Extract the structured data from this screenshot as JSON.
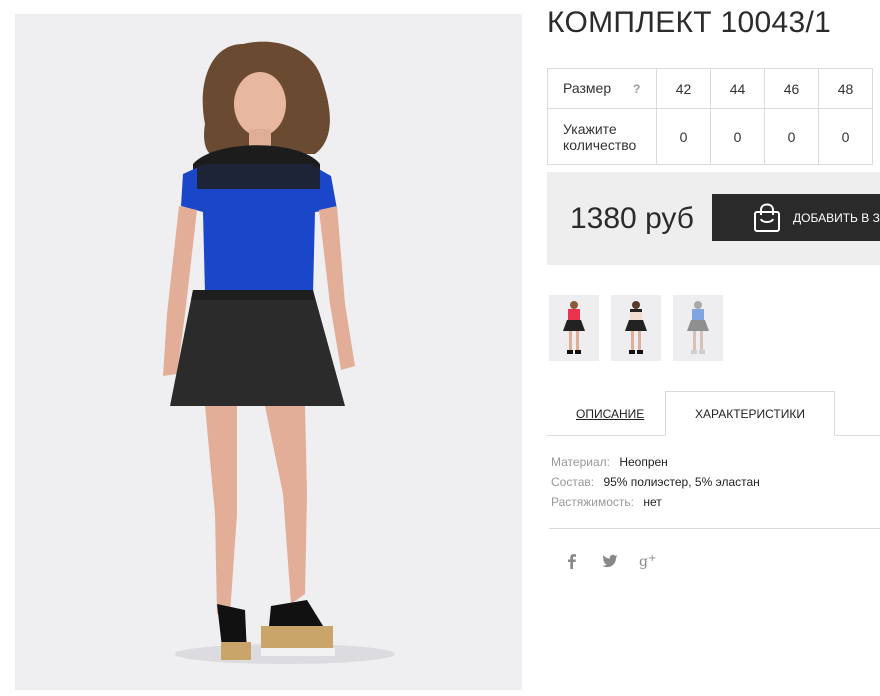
{
  "product": {
    "title": "КОМПЛЕКТ 10043/1"
  },
  "size_table": {
    "size_label": "Размер",
    "help_icon": "?",
    "qty_label_line1": "Укажите",
    "qty_label_line2": "количество",
    "sizes": [
      "42",
      "44",
      "46",
      "48"
    ],
    "quantities": [
      "0",
      "0",
      "0",
      "0"
    ]
  },
  "purchase": {
    "price": "1380 руб",
    "add_to_cart_label": "ДОБАВИТЬ В З",
    "cart_icon": "shopping-bag-icon"
  },
  "tabs": {
    "description": "ОПИСАНИЕ",
    "characteristics": "ХАРАКТЕРИСТИКИ"
  },
  "specs": [
    {
      "key": "Материал:",
      "value": "Неопрен"
    },
    {
      "key": "Состав:",
      "value": "95% полиэстер, 5% эластан"
    },
    {
      "key": "Растяжимость:",
      "value": "нет"
    }
  ],
  "social": [
    "facebook-icon",
    "twitter-icon",
    "google-plus-icon"
  ],
  "colors": {
    "top_blue": "#1a47c9",
    "button_dark": "#2a2a2a",
    "price_bg": "#eeeeee"
  }
}
